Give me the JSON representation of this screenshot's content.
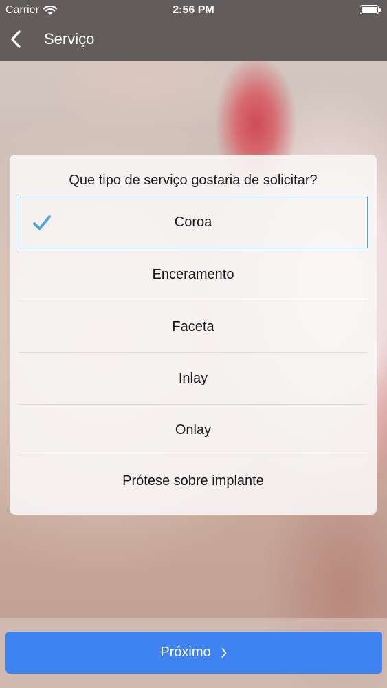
{
  "status_bar": {
    "carrier": "Carrier",
    "time": "2:56 PM",
    "battery_level": 1.0
  },
  "nav": {
    "title": "Serviço",
    "back_icon": "chevron-left-icon"
  },
  "card": {
    "question": "Que tipo de serviço gostaria de solicitar?",
    "options": [
      {
        "label": "Coroa",
        "selected": true
      },
      {
        "label": "Enceramento",
        "selected": false
      },
      {
        "label": "Faceta",
        "selected": false
      },
      {
        "label": "Inlay",
        "selected": false
      },
      {
        "label": "Onlay",
        "selected": false
      },
      {
        "label": "Prótese sobre implante",
        "selected": false
      }
    ],
    "check_icon": "checkmark-icon"
  },
  "footer": {
    "next_label": "Próximo",
    "next_icon": "chevron-right-icon"
  },
  "colors": {
    "accent": "#3f83f0",
    "selection_border": "#4fa7d6",
    "nav_background": "#585452"
  }
}
